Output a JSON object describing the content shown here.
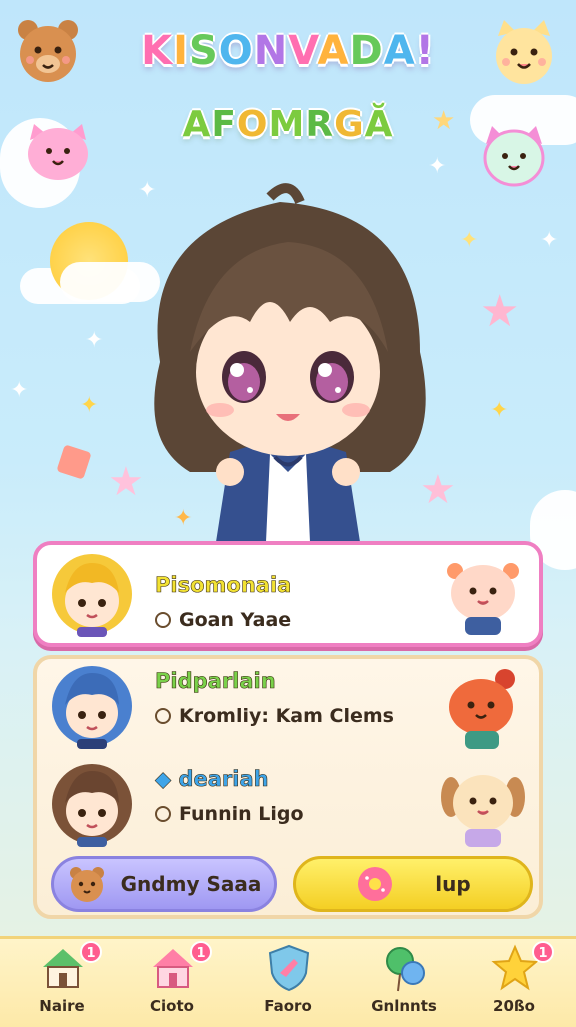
{
  "header": {
    "title": "KISONVADA!",
    "subtitle": "AFOMRGĂ"
  },
  "players": [
    {
      "name": "Pisomonaia",
      "stat": "Goan Yaae",
      "name_color": "#f2e233"
    },
    {
      "name": "Pidparlain",
      "stat": "Kromliy: Kam Clems",
      "name_color": "#7ad14a"
    },
    {
      "name": "deariah",
      "stat": "Funnin Ligo",
      "name_color": "#3ea4e8"
    }
  ],
  "actions": {
    "left_label": "Gndmy Saaa",
    "right_label": "lup"
  },
  "nav": [
    {
      "label": "Naire",
      "icon": "house-icon",
      "badge": "1"
    },
    {
      "label": "Cioto",
      "icon": "shop-icon",
      "badge": "1"
    },
    {
      "label": "Faoro",
      "icon": "shield-icon",
      "badge": ""
    },
    {
      "label": "Gnlnnts",
      "icon": "balloon-icon",
      "badge": ""
    },
    {
      "label": "20ßo",
      "icon": "star-icon",
      "badge": "1"
    }
  ],
  "colors": {
    "accent_pink": "#ef7fc2",
    "nav_bg": "#fde9a8",
    "button_purple": "#9f98f2",
    "button_yellow": "#f4cf24"
  }
}
